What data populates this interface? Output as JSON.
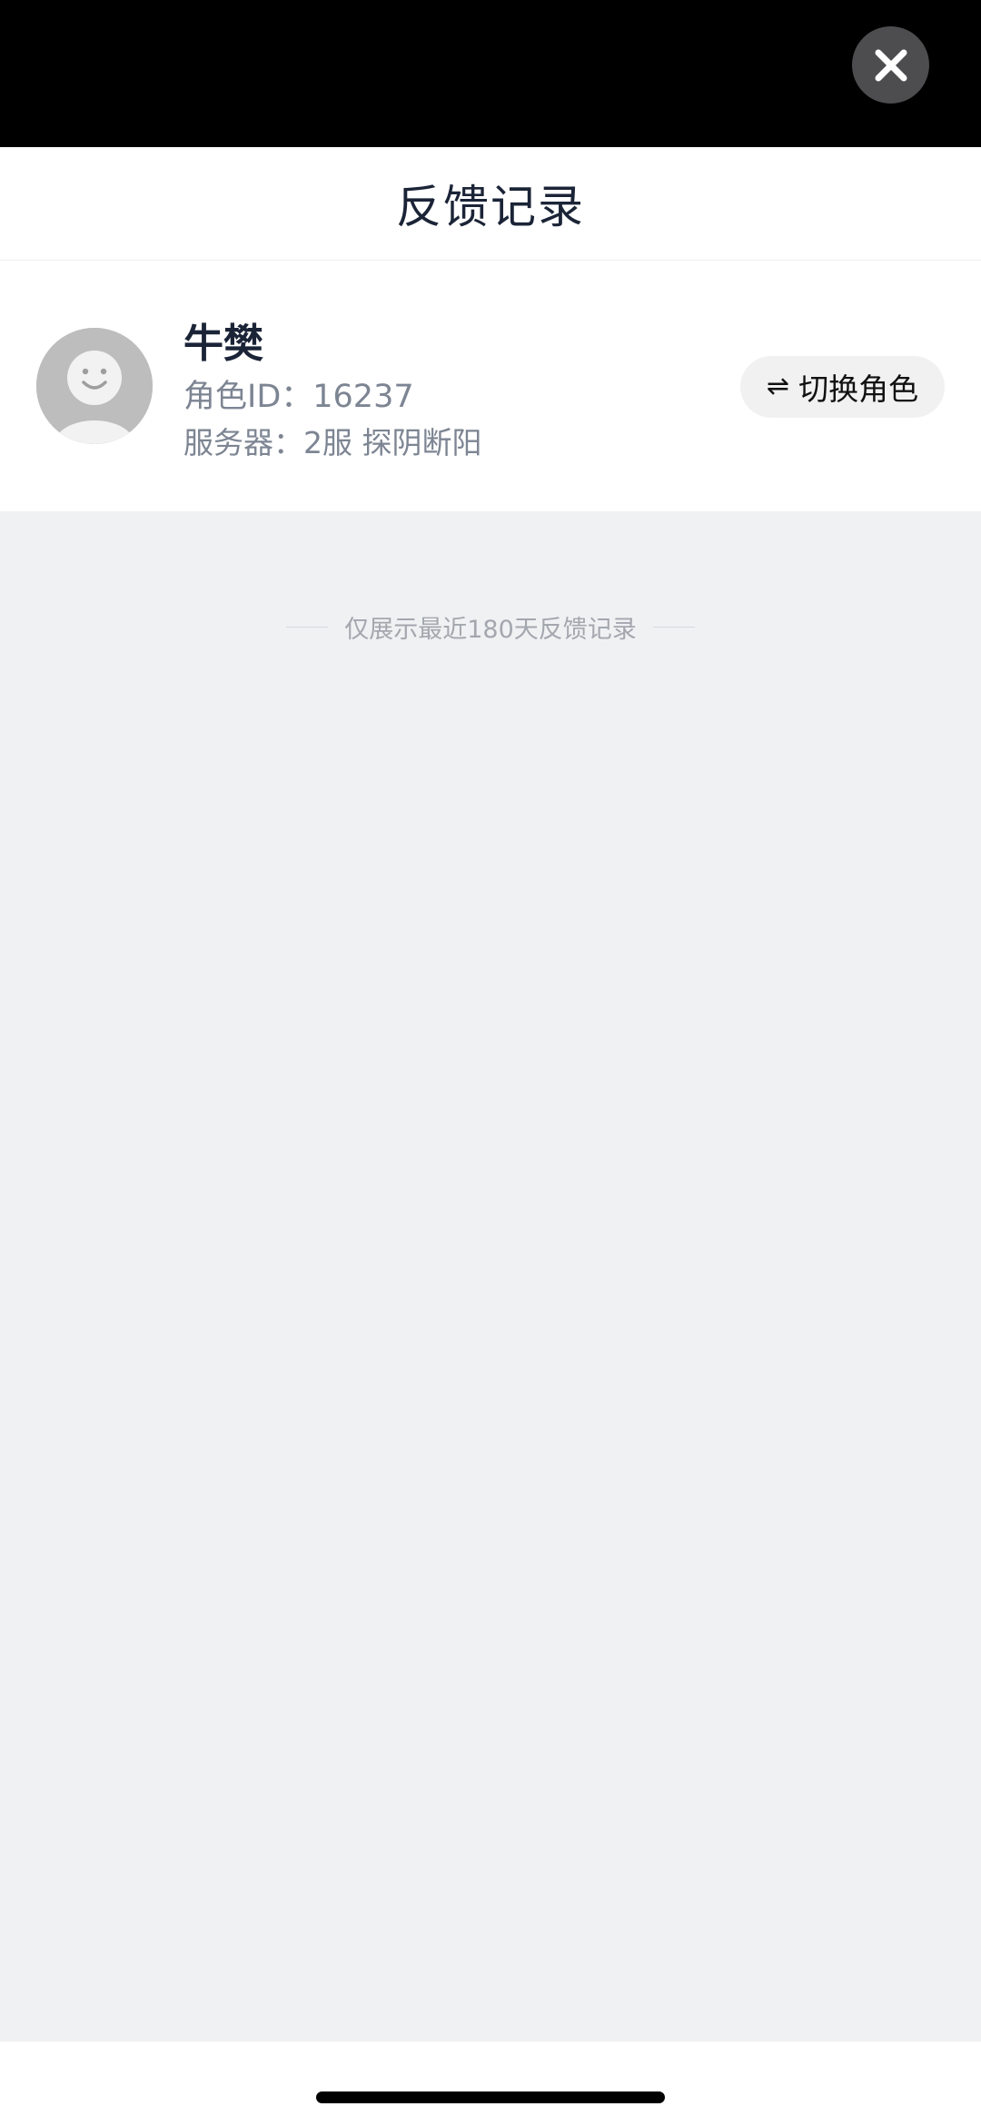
{
  "header": {
    "title": "反馈记录",
    "close_icon": "close-icon"
  },
  "profile": {
    "avatar_icon": "avatar-placeholder-icon",
    "name": "牛樊",
    "role_id": "角色ID：16237",
    "server": "服务器：2服 探阴断阳",
    "switch_icon": "switch-arrows-icon",
    "switch_label": "切换角色"
  },
  "content": {
    "notice": "仅展示最近180天反馈记录"
  },
  "colors": {
    "title_text": "#1b2437",
    "secondary_text": "#7d8593",
    "page_background": "#f0f1f3"
  }
}
